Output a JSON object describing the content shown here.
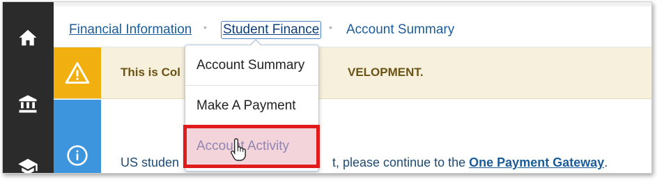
{
  "breadcrumb": {
    "items": [
      "Financial Information",
      "Student Finance",
      "Account Summary"
    ],
    "separator": "•"
  },
  "warning": {
    "text_left": "This is Col",
    "text_right": "VELOPMENT.",
    "icon": "warning-triangle-icon",
    "color": "#f1b00f"
  },
  "info": {
    "text_left": "US studen",
    "text_right": "t, please continue to the",
    "link": "One Payment Gateway",
    "trailing": ".",
    "icon": "info-circle-icon",
    "color": "#3d96dd"
  },
  "dropdown": {
    "items": [
      "Account Summary",
      "Make A Payment",
      "Account Activity"
    ],
    "highlighted_index": 2,
    "highlight_color": "#e01b1b"
  },
  "sidebar": {
    "icons": [
      "home-icon",
      "bank-icon",
      "graduation-cap-icon"
    ]
  }
}
